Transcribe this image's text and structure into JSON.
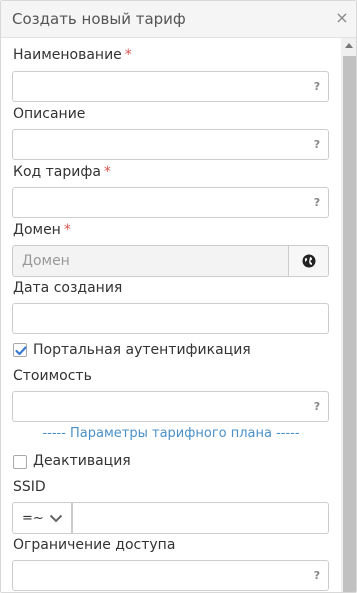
{
  "dialog": {
    "title": "Создать новый тариф",
    "close_symbol": "×"
  },
  "fields": {
    "name": {
      "label": "Наименование",
      "required_mark": "*",
      "help": "?"
    },
    "description": {
      "label": "Описание",
      "help": "?"
    },
    "tariff_code": {
      "label": "Код тарифа",
      "required_mark": "*",
      "help": "?"
    },
    "domain": {
      "label": "Домен",
      "required_mark": "*",
      "placeholder": "Домен",
      "button_icon": "globe-icon"
    },
    "created_date": {
      "label": "Дата создания"
    },
    "portal_auth": {
      "label": "Портальная аутентификация",
      "checked": true
    },
    "cost": {
      "label": "Стоимость",
      "help": "?"
    },
    "plan_params_link": "----- Параметры тарифного плана -----",
    "deactivation": {
      "label": "Деактивация",
      "checked": false
    },
    "ssid": {
      "label": "SSID",
      "operator": "=~"
    },
    "access_limit": {
      "label": "Ограничение доступа",
      "help": "?"
    }
  },
  "colors": {
    "required": "#d9534f",
    "link": "#4a90c8",
    "checkbox_check": "#3a7bd5"
  }
}
